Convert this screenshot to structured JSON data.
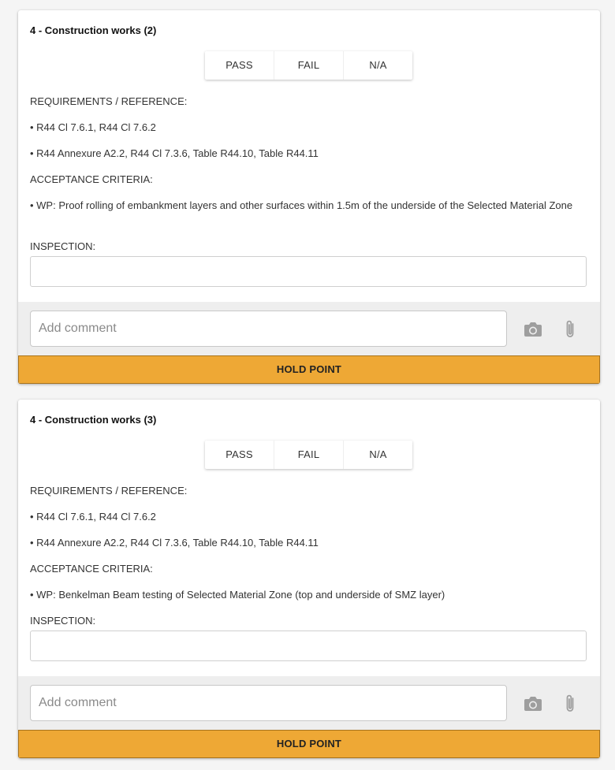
{
  "cards": [
    {
      "title": "4 - Construction works (2)",
      "options": [
        "PASS",
        "FAIL",
        "N/A"
      ],
      "requirements_heading": "REQUIREMENTS / REFERENCE:",
      "requirements": [
        "• R44 Cl 7.6.1, R44 Cl 7.6.2",
        "• R44 Annexure A2.2, R44 Cl 7.3.6, Table R44.10, Table R44.11"
      ],
      "acceptance_heading": "ACCEPTANCE CRITERIA:",
      "acceptance": "• WP: Proof rolling of embankment layers and other surfaces within 1.5m of the underside of the Selected Material Zone",
      "inspection_heading": "INSPECTION:",
      "inspection_value": "",
      "comment_placeholder": "Add comment",
      "hold_label": "HOLD POINT"
    },
    {
      "title": "4 - Construction works (3)",
      "options": [
        "PASS",
        "FAIL",
        "N/A"
      ],
      "requirements_heading": "REQUIREMENTS / REFERENCE:",
      "requirements": [
        "• R44 Cl 7.6.1, R44 Cl 7.6.2",
        "• R44 Annexure A2.2, R44 Cl 7.3.6, Table R44.10, Table R44.11"
      ],
      "acceptance_heading": "ACCEPTANCE CRITERIA:",
      "acceptance": "• WP: Benkelman Beam testing of Selected Material Zone (top and underside of SMZ layer)",
      "inspection_heading": "INSPECTION:",
      "inspection_value": "",
      "comment_placeholder": "Add comment",
      "hold_label": "HOLD POINT"
    }
  ],
  "icons": {
    "camera": "camera-icon",
    "attach": "paperclip-icon"
  },
  "colors": {
    "hold_bar": "#eea835",
    "icon_grey": "#9e9e9e",
    "footer_bg": "#eeeeee"
  }
}
